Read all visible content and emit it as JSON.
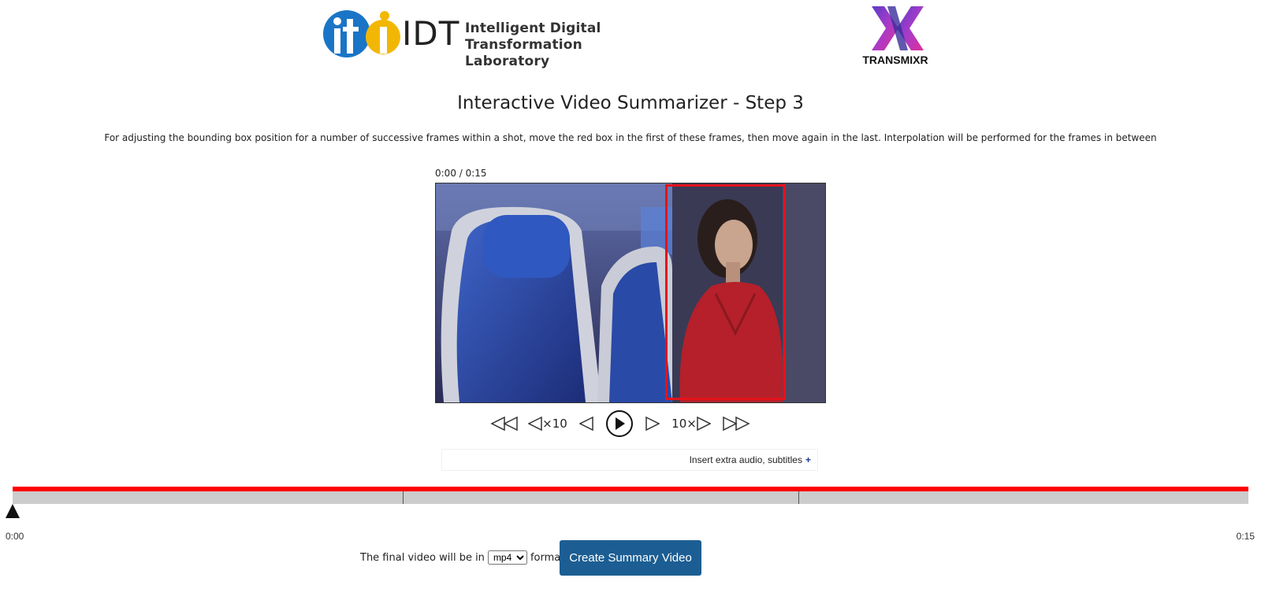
{
  "header": {
    "iti_logo_letters": "iti",
    "idt_word": "IDT",
    "lab_name_line1": "Intelligent Digital Transformation",
    "lab_name_line2": "Laboratory",
    "partner_name": "TRANSMIXR"
  },
  "page": {
    "title": "Interactive Video Summarizer - Step 3",
    "instructions": "For adjusting the bounding box position for a number of successive frames within a shot, move the red box in the first of these frames, then move again in the last. Interpolation will be performed for the frames in between"
  },
  "player": {
    "time_readout": "0:00 / 0:15",
    "controls": {
      "back_x10_label": "×10",
      "forward_x10_label": "10×"
    },
    "extras_label": "Insert extra audio, subtitles",
    "extras_plus": "+"
  },
  "timeline": {
    "start_label": "0:00",
    "end_label": "0:15",
    "playhead_fraction": 0,
    "shot_boundaries_fraction": [
      0.316,
      0.636
    ]
  },
  "export": {
    "format_prefix": "The final video will be in",
    "format_value": "mp4",
    "format_options": [
      "mp4"
    ],
    "format_suffix": "format.",
    "create_button": "Create Summary Video"
  },
  "colors": {
    "bbox": "#e3131b",
    "timeline_red": "#ff0000",
    "timeline_gray": "#cccccc",
    "button": "#1c5e93",
    "iti_blue": "#1a75c7",
    "iti_yellow": "#f2b705"
  }
}
